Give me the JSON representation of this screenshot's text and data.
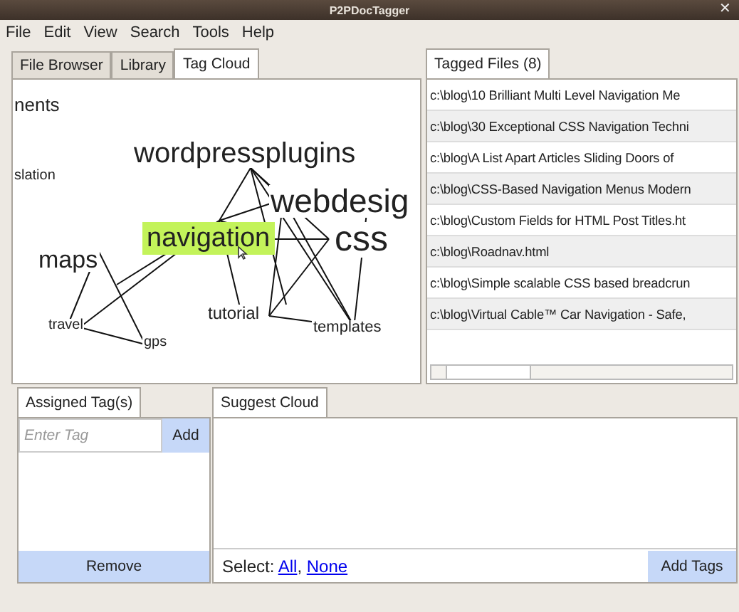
{
  "window": {
    "title": "P2PDocTagger",
    "close": "✕"
  },
  "menu": [
    "File",
    "Edit",
    "View",
    "Search",
    "Tools",
    "Help"
  ],
  "left_tabs": [
    {
      "label": "File Browser",
      "selected": false
    },
    {
      "label": "Library",
      "selected": false
    },
    {
      "label": "Tag Cloud",
      "selected": true
    }
  ],
  "tag_cloud": [
    {
      "tag": "nents",
      "selected": false
    },
    {
      "tag": "slation",
      "selected": false
    },
    {
      "tag": "wordpressplugins",
      "selected": false
    },
    {
      "tag": "webdesig",
      "selected": false
    },
    {
      "tag": "navigation",
      "selected": true
    },
    {
      "tag": "css",
      "selected": false
    },
    {
      "tag": "maps",
      "selected": false
    },
    {
      "tag": "tutorial",
      "selected": false
    },
    {
      "tag": "travel",
      "selected": false
    },
    {
      "tag": "templates",
      "selected": false
    },
    {
      "tag": "gps",
      "selected": false
    }
  ],
  "right_tabs": [
    {
      "label": "Tagged Files (8)",
      "selected": true
    }
  ],
  "tagged_files": [
    "c:\\blog\\10 Brilliant Multi Level Navigation Me",
    "c:\\blog\\30 Exceptional CSS Navigation Techni",
    "c:\\blog\\A List Apart  Articles  Sliding Doors of",
    "c:\\blog\\CSS-Based Navigation Menus  Modern",
    "c:\\blog\\Custom Fields for HTML Post Titles.ht",
    "c:\\blog\\Roadnav.html",
    "c:\\blog\\Simple scalable CSS based breadcrun",
    "c:\\blog\\Virtual Cable™ Car Navigation - Safe,"
  ],
  "assigned": {
    "tab": "Assigned Tag(s)",
    "placeholder": "Enter Tag",
    "add": "Add",
    "remove": "Remove"
  },
  "suggest": {
    "tab": "Suggest Cloud",
    "select_label": "Select:",
    "links": [
      "All",
      "None"
    ],
    "separator": ",",
    "add_tags": "Add Tags"
  }
}
